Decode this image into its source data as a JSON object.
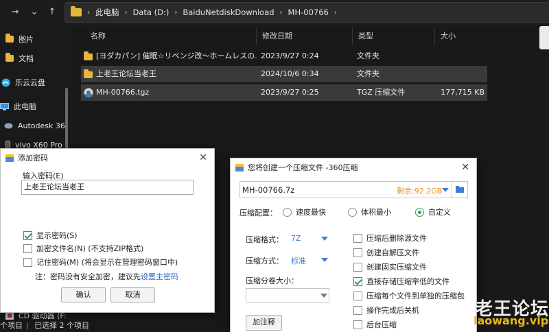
{
  "explorer": {
    "breadcrumb": [
      "此电脑",
      "Data (D:)",
      "BaiduNetdiskDownload",
      "MH-00766"
    ],
    "sidebar": [
      "图片",
      "文档",
      "乐云云盘",
      "此电脑",
      "Autodesk 36",
      "vivo X60 Pro",
      "CD 驱动器 (F:"
    ],
    "columns": [
      "名称",
      "修改日期",
      "类型",
      "大小"
    ],
    "rows": [
      {
        "name": "[ヨダカパン] 催眠☆リベンジ改～ホームレスの...",
        "date": "2023/9/27 0:24",
        "type": "文件夹",
        "size": ""
      },
      {
        "name": "上老王论坛当老王",
        "date": "2024/10/6 0:34",
        "type": "文件夹",
        "size": ""
      },
      {
        "name": "MH-00766.tgz",
        "date": "2023/9/27 0:25",
        "type": "TGZ 压缩文件",
        "size": "177,715 KB"
      }
    ],
    "status_items": "个项目",
    "status_selected": "已选择 2 个项目"
  },
  "password_dialog": {
    "title": "添加密码",
    "label": "输入密码(E)",
    "value": "上老王论坛当老王",
    "options": [
      {
        "label": "显示密码(S)",
        "checked": true
      },
      {
        "label": "加密文件名(N) (不支持ZIP格式)",
        "checked": false
      },
      {
        "label": "记住密码(M) (将会显示在管理密码窗口中)",
        "checked": false
      }
    ],
    "note": "注：密码没有安全加密，建议先",
    "note_link": "设置主密码",
    "ok": "确认",
    "cancel": "取消"
  },
  "compress_dialog": {
    "title": "您将创建一个压缩文件 -360压缩",
    "filename": "MH-00766.7z",
    "free": "剩余:92.2GB",
    "config_label": "压缩配置：",
    "configs": [
      {
        "label": "速度最快",
        "on": false
      },
      {
        "label": "体积最小",
        "on": false
      },
      {
        "label": "自定义",
        "on": true
      }
    ],
    "format_label": "压缩格式：",
    "format_value": "7Z",
    "method_label": "压缩方式：",
    "method_value": "标准",
    "split_label": "压缩分卷大小：",
    "comment_btn": "加注释",
    "checks": [
      {
        "label": "压缩后删除源文件",
        "on": false
      },
      {
        "label": "创建自解压文件",
        "on": false
      },
      {
        "label": "创建固实压缩文件",
        "on": false
      },
      {
        "label": "直接存储压缩率低的文件",
        "on": true
      },
      {
        "label": "压缩每个文件到单独的压缩包",
        "on": false
      },
      {
        "label": "操作完成后关机",
        "on": false
      },
      {
        "label": "后台压缩",
        "on": false
      }
    ]
  },
  "watermark": {
    "line1": "老王论坛",
    "line2": "laowang.vip"
  }
}
